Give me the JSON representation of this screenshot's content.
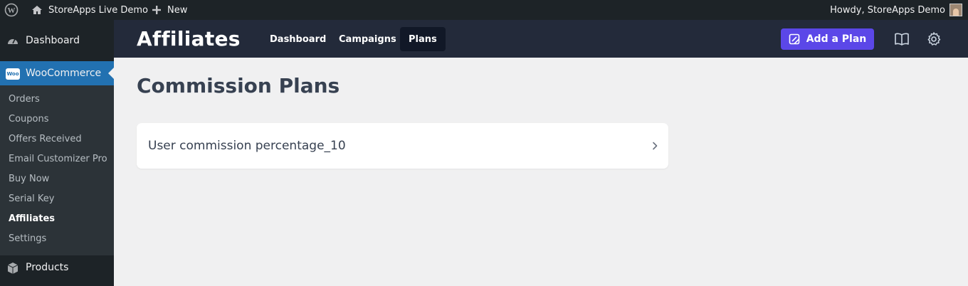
{
  "admin_bar": {
    "site_name": "StoreApps Live Demo",
    "new_label": "New",
    "greeting": "Howdy, StoreApps Demo"
  },
  "sidebar": {
    "dashboard": "Dashboard",
    "woocommerce": "WooCommerce",
    "woo_badge": "Woo",
    "submenu": [
      "Orders",
      "Coupons",
      "Offers Received",
      "Email Customizer Pro",
      "Buy Now",
      "Serial Key",
      "Affiliates",
      "Settings"
    ],
    "current": "Affiliates",
    "products": "Products"
  },
  "plugin_header": {
    "brand": "Affiliates",
    "nav": [
      "Dashboard",
      "Campaigns",
      "Plans"
    ],
    "active_nav": "Plans",
    "add_button": "Add a Plan"
  },
  "main": {
    "title": "Commission Plans",
    "plans": [
      {
        "name": "User commission percentage_10"
      }
    ]
  },
  "colors": {
    "admin_bg": "#1d2327",
    "woo_active": "#2271b1",
    "header_bg": "#232a3a",
    "accent": "#5b47e8"
  }
}
